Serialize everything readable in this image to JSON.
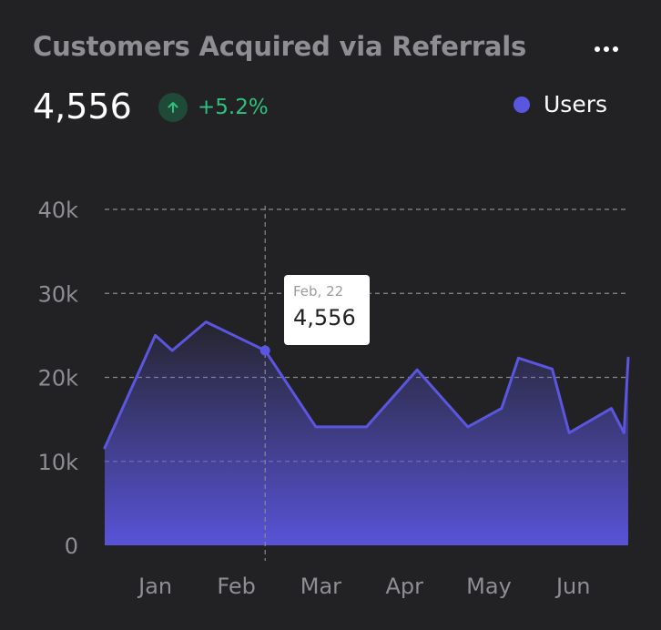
{
  "header": {
    "title": "Customers Acquired via Referrals",
    "menu_icon": "more-horizontal-icon"
  },
  "summary": {
    "value": "4,556",
    "trend_icon": "arrow-up-icon",
    "change": "+5.2%"
  },
  "legend": {
    "label": "Users"
  },
  "tooltip": {
    "date": "Feb, 22",
    "value": "4,556"
  },
  "colors": {
    "background": "#222224",
    "title": "#8e8e93",
    "series": "#5b56e0",
    "positive": "#2ec27e",
    "positive_bg": "#1f4a38",
    "grid": "#8a8a8e"
  },
  "chart_data": {
    "type": "area",
    "title": "Customers Acquired via Referrals",
    "ylim": [
      0,
      40000
    ],
    "yticks": [
      0,
      10000,
      20000,
      30000,
      40000
    ],
    "ytick_labels": [
      "0",
      "10k",
      "20k",
      "30k",
      "40k"
    ],
    "xlim": [
      0,
      6.2
    ],
    "xticks": [
      0.6,
      1.56,
      2.56,
      3.55,
      4.55,
      5.55
    ],
    "xtick_labels": [
      "Jan",
      "Feb",
      "Mar",
      "Apr",
      "May",
      "Jun"
    ],
    "grid": true,
    "legend_position": "top-right",
    "highlight": {
      "x": 1.9,
      "y": 23200,
      "label": "Feb, 22",
      "value": "4,556"
    },
    "series": [
      {
        "name": "Users",
        "points": [
          [
            0.0,
            11600
          ],
          [
            0.6,
            25000
          ],
          [
            0.8,
            23200
          ],
          [
            1.2,
            26600
          ],
          [
            1.9,
            23200
          ],
          [
            2.5,
            14100
          ],
          [
            3.1,
            14100
          ],
          [
            3.7,
            20900
          ],
          [
            4.3,
            14100
          ],
          [
            4.7,
            16300
          ],
          [
            4.9,
            22300
          ],
          [
            5.3,
            21000
          ],
          [
            5.5,
            13400
          ],
          [
            6.0,
            16300
          ],
          [
            6.15,
            13400
          ],
          [
            6.2,
            22300
          ]
        ]
      }
    ]
  }
}
